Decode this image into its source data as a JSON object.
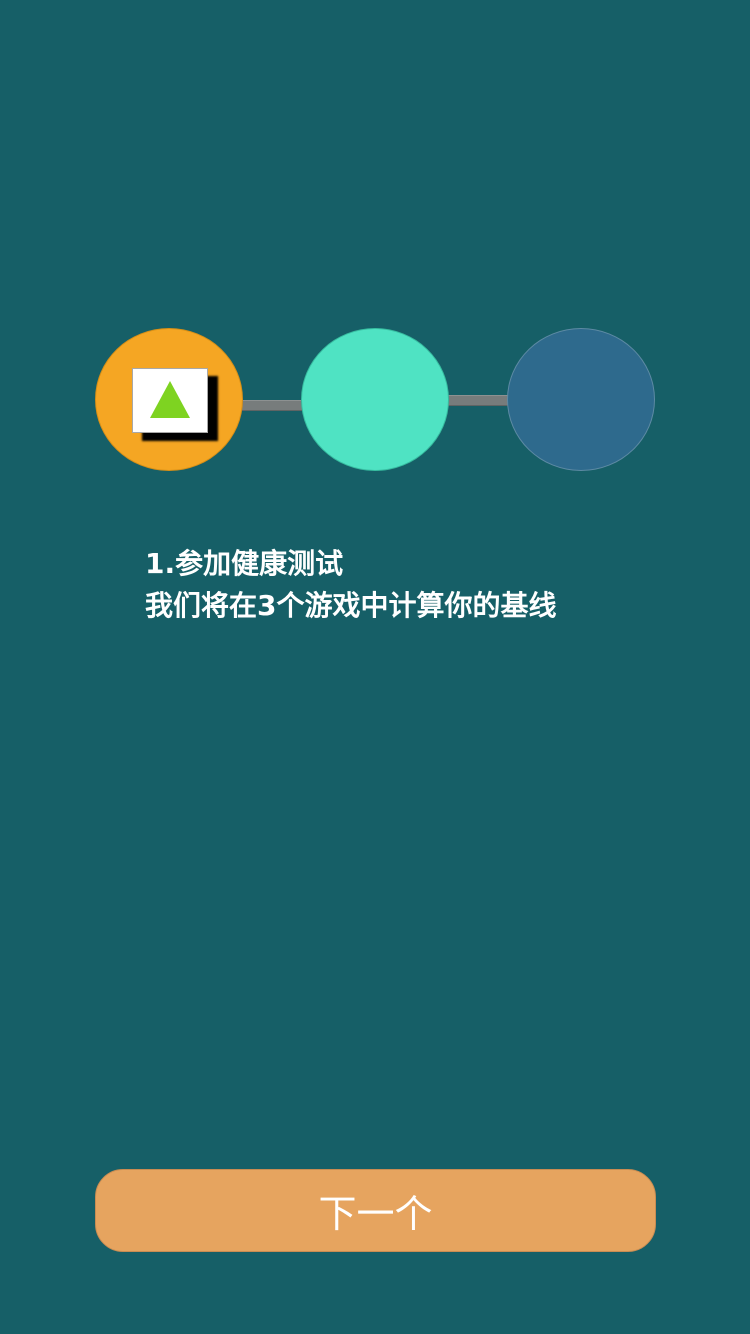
{
  "onboarding": {
    "steps": [
      {
        "state": "active",
        "color": "#f5a623",
        "icon": "triangle-icon"
      },
      {
        "state": "upcoming",
        "color": "#4fe3c3"
      },
      {
        "state": "upcoming",
        "color": "#2e6a8d"
      }
    ],
    "title": "1.参加健康测试",
    "description": "我们将在3个游戏中计算你的基线"
  },
  "actions": {
    "next_label": "下一个"
  },
  "colors": {
    "background": "#165f67",
    "connector": "#777c7c",
    "button": "#e6a45f",
    "text": "#ffffff"
  }
}
